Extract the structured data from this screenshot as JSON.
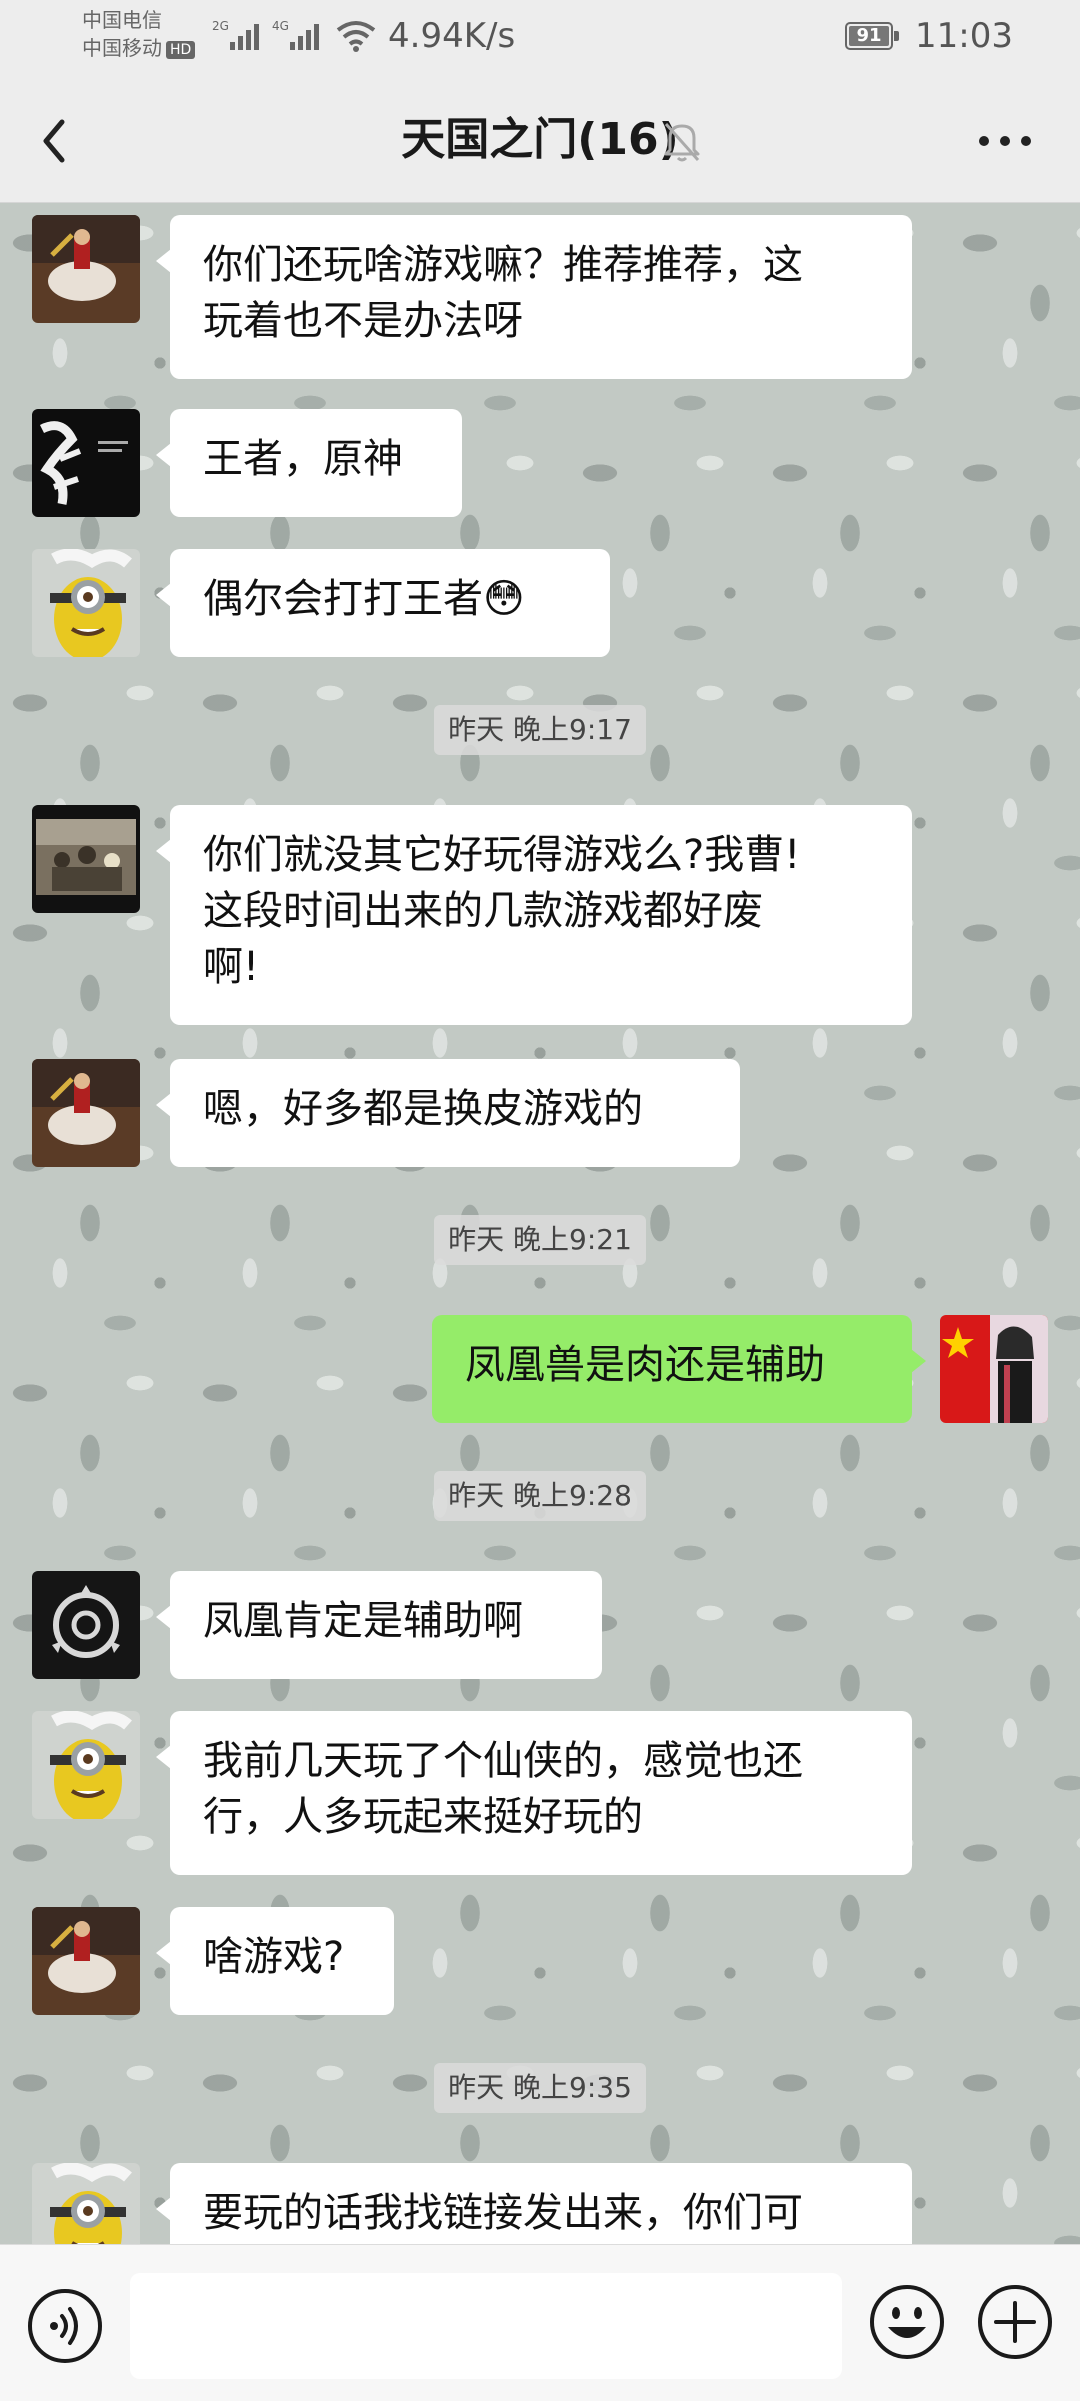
{
  "status_bar": {
    "carrier_1": "中国电信",
    "carrier_2": "中国移动",
    "hd_badge": "HD",
    "signal_1_label": "2G",
    "signal_2_label": "4G",
    "net_speed": "4.94K/s",
    "battery": "91",
    "time": "11:03"
  },
  "header": {
    "title": "天国之门(16)",
    "back_icon": "chevron-left-icon",
    "mute_icon": "bell-off-icon",
    "more_icon": "more-dots-icon"
  },
  "messages": [
    {
      "type": "in",
      "avatar": "horseman-painting",
      "text": "你们还玩啥游戏嘛？推荐推荐，这\n玩着也不是办法呀"
    },
    {
      "type": "in",
      "avatar": "black-calligraphy",
      "text": "王者，原神"
    },
    {
      "type": "in",
      "avatar": "minion",
      "text": "偶尔会打打王者😳"
    },
    {
      "type": "time",
      "text": "昨天 晚上9:17"
    },
    {
      "type": "in",
      "avatar": "army-photo",
      "text": "你们就没其它好玩得游戏么?我曹!\n这段时间出来的几款游戏都好废\n啊!"
    },
    {
      "type": "in",
      "avatar": "horseman-painting",
      "text": "嗯，好多都是换皮游戏的"
    },
    {
      "type": "time",
      "text": "昨天 晚上9:21"
    },
    {
      "type": "out",
      "avatar": "flag-character",
      "text": "凤凰兽是肉还是辅助"
    },
    {
      "type": "time",
      "text": "昨天 晚上9:28"
    },
    {
      "type": "in",
      "avatar": "scp-logo",
      "text": "凤凰肯定是辅助啊"
    },
    {
      "type": "in",
      "avatar": "minion",
      "text": "我前几天玩了个仙侠的，感觉也还\n行，人多玩起来挺好玩的"
    },
    {
      "type": "in",
      "avatar": "horseman-painting",
      "text": "啥游戏?"
    },
    {
      "type": "time",
      "text": "昨天 晚上9:35"
    },
    {
      "type": "in",
      "avatar": "minion",
      "text": "要玩的话我找链接发出来，你们可"
    }
  ],
  "input_bar": {
    "voice_icon": "voice-icon",
    "message_value": "",
    "emoji_icon": "emoji-icon",
    "plus_icon": "plus-icon"
  },
  "colors": {
    "header_bg": "#ededed",
    "bubble_in": "#ffffff",
    "bubble_out": "#95ec69",
    "input_bar_bg": "#f7f7f7"
  }
}
